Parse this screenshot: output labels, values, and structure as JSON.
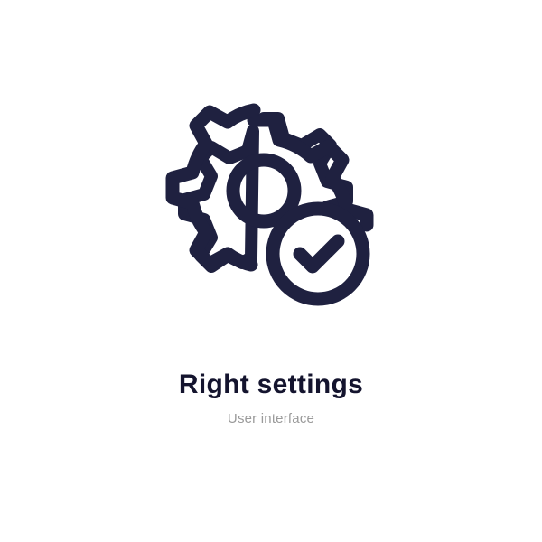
{
  "icon": {
    "name": "right-settings",
    "stroke_color": "#1f2140"
  },
  "title": "Right settings",
  "subtitle": "User interface"
}
